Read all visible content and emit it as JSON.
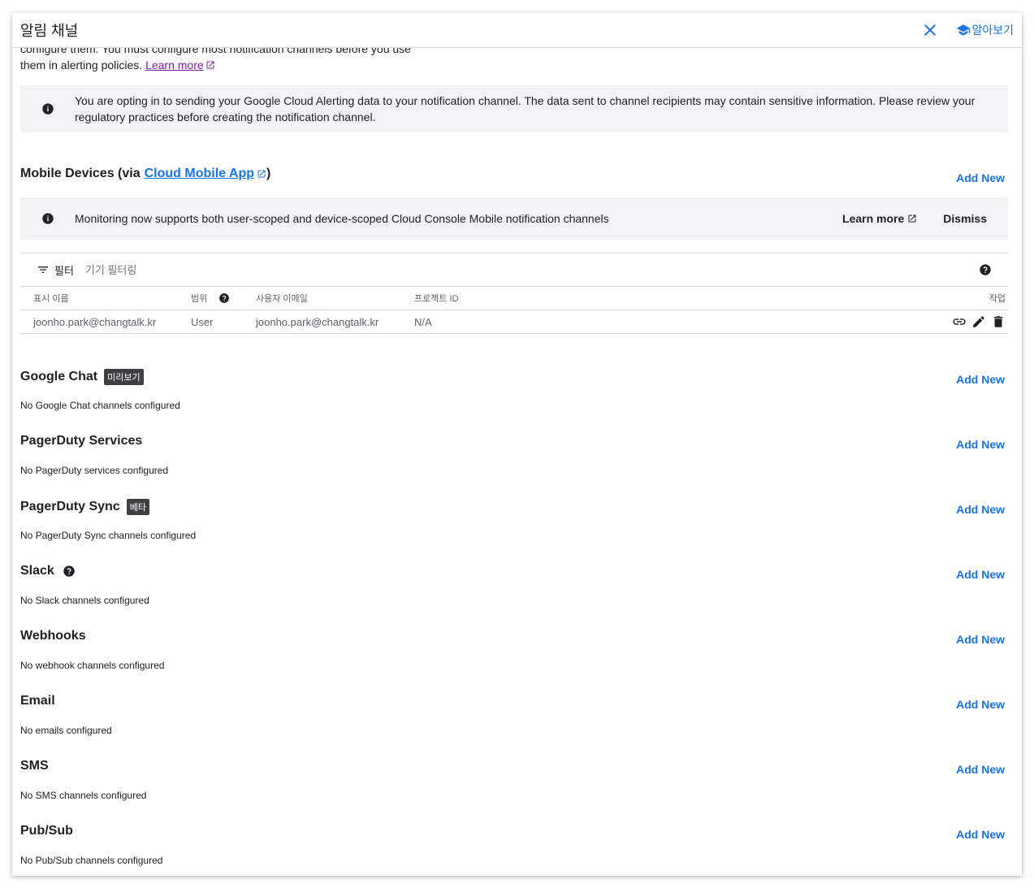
{
  "header": {
    "title": "알림 채널",
    "learn_label": "알아보기"
  },
  "intro": {
    "line1": "configure them. You must configure most notification channels before you use",
    "line2": "them in alerting policies.",
    "learn_more": "Learn more"
  },
  "notice": "You are opting in to sending your Google Cloud Alerting data to your notification channel. The data sent to channel recipients may contain sensitive information. Please review your regulatory practices before creating the notification channel.",
  "mobile": {
    "title_prefix": "Mobile Devices (via",
    "app_link": "Cloud Mobile App",
    "title_suffix": ")",
    "add_new": "Add New",
    "banner_text": "Monitoring now supports both user-scoped and device-scoped Cloud Console Mobile notification channels",
    "banner_learn": "Learn more",
    "banner_dismiss": "Dismiss",
    "filter_label": "필터",
    "filter_placeholder": "기기 필터링",
    "columns": [
      "표시 이름",
      "범위",
      "사용자 이메일",
      "프로젝트 ID",
      "작업"
    ],
    "rows": [
      {
        "name": "joonho.park@changtalk.kr",
        "scope": "User",
        "email": "joonho.park@changtalk.kr",
        "project": "N/A"
      }
    ]
  },
  "sections": [
    {
      "title": "Google Chat",
      "badge": "미리보기",
      "add_new": "Add New",
      "empty": "No Google Chat channels configured"
    },
    {
      "title": "PagerDuty Services",
      "add_new": "Add New",
      "empty": "No PagerDuty services configured"
    },
    {
      "title": "PagerDuty Sync",
      "badge": "베타",
      "add_new": "Add New",
      "empty": "No PagerDuty Sync channels configured"
    },
    {
      "title": "Slack",
      "add_new": "Add New",
      "empty": "No Slack channels configured"
    },
    {
      "title": "Webhooks",
      "add_new": "Add New",
      "empty": "No webhook channels configured"
    },
    {
      "title": "Email",
      "add_new": "Add New",
      "empty": "No emails configured"
    },
    {
      "title": "SMS",
      "add_new": "Add New",
      "empty": "No SMS channels configured"
    },
    {
      "title": "Pub/Sub",
      "add_new": "Add New",
      "empty": "No Pub/Sub channels configured"
    }
  ],
  "colors": {
    "accent": "#1a73e8",
    "link_visited": "#7b1fa2",
    "banner_bg": "#f1f3f4",
    "badge_bg": "#3c4043"
  }
}
